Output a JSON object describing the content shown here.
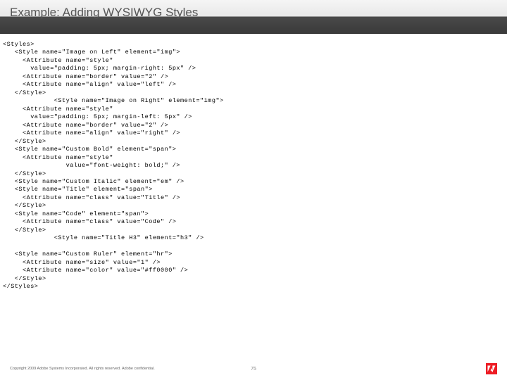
{
  "slide": {
    "title": "Example: Adding WYSIWYG Styles"
  },
  "code": "<Styles>\n   <Style name=\"Image on Left\" element=\"img\">\n     <Attribute name=\"style\"\n       value=\"padding: 5px; margin-right: 5px\" />\n     <Attribute name=\"border\" value=\"2\" />\n     <Attribute name=\"align\" value=\"left\" />\n   </Style>\n             <Style name=\"Image on Right\" element=\"img\">\n     <Attribute name=\"style\"\n       value=\"padding: 5px; margin-left: 5px\" />\n     <Attribute name=\"border\" value=\"2\" />\n     <Attribute name=\"align\" value=\"right\" />\n   </Style>\n   <Style name=\"Custom Bold\" element=\"span\">\n     <Attribute name=\"style\"\n                value=\"font-weight: bold;\" />\n   </Style>\n   <Style name=\"Custom Italic\" element=\"em\" />\n   <Style name=\"Title\" element=\"span\">\n     <Attribute name=\"class\" value=\"Title\" />\n   </Style>\n   <Style name=\"Code\" element=\"span\">\n     <Attribute name=\"class\" value=\"Code\" />\n   </Style>\n             <Style name=\"Title H3\" element=\"h3\" />\n\n   <Style name=\"Custom Ruler\" element=\"hr\">\n     <Attribute name=\"size\" value=\"1\" />\n     <Attribute name=\"color\" value=\"#ff0000\" />\n   </Style>\n</Styles>",
  "footer": {
    "copyright": "Copyright 2009 Adobe Systems Incorporated. All rights reserved. Adobe confidential.",
    "page": "75"
  }
}
